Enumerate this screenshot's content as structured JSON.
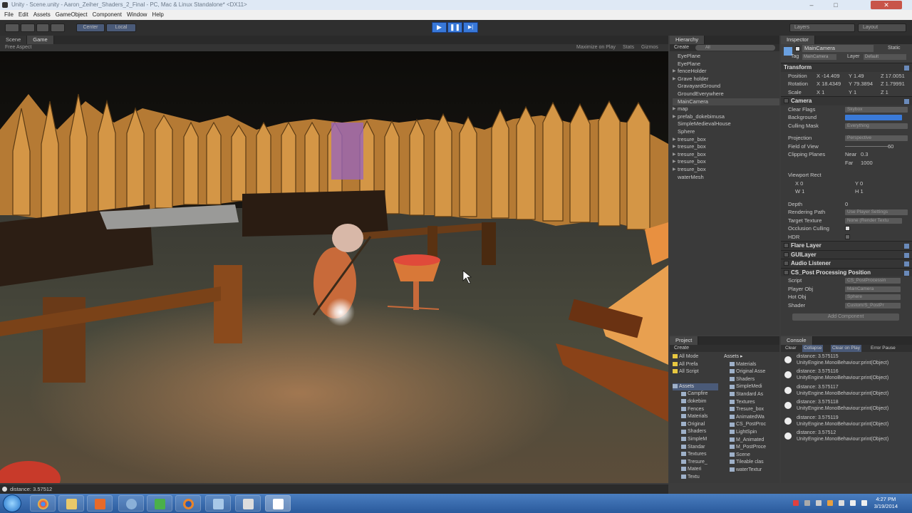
{
  "window": {
    "title": "Unity - Scene.unity - Aaron_Zeiher_Shaders_2_Final - PC, Mac & Linux Standalone* <DX11>",
    "min": "–",
    "max": "□",
    "close": "✕"
  },
  "menu": [
    "File",
    "Edit",
    "Assets",
    "GameObject",
    "Component",
    "Window",
    "Help"
  ],
  "toolbar": {
    "pivot": "Center",
    "space": "Local",
    "play": "▶",
    "pause": "❚❚",
    "step": "▶|",
    "layers": "Layers",
    "layout": "Layout"
  },
  "scene_tabs": {
    "scene": "Scene",
    "game": "Game",
    "aspect": "Free Aspect",
    "maximize": "Maximize on Play",
    "stats": "Stats",
    "gizmos": "Gizmos"
  },
  "status_message": "distance: 3.57512",
  "hierarchy": {
    "tab": "Hierarchy",
    "create": "Create",
    "search": "All",
    "items": [
      {
        "label": "EyePlane",
        "expand": false
      },
      {
        "label": "EyePlane",
        "expand": false
      },
      {
        "label": "fenceHolder",
        "expand": true
      },
      {
        "label": "Grave holder",
        "expand": true
      },
      {
        "label": "GravayardGround",
        "expand": false
      },
      {
        "label": "GroundEverywhere",
        "expand": false
      },
      {
        "label": "MainCamera",
        "expand": false,
        "selected": true
      },
      {
        "label": "map",
        "expand": true
      },
      {
        "label": "prefab_dokebimusa",
        "expand": true
      },
      {
        "label": "SimpleMedievalHouse",
        "expand": false
      },
      {
        "label": "Sphere",
        "expand": false
      },
      {
        "label": "tresure_box",
        "expand": true
      },
      {
        "label": "tresure_box",
        "expand": true
      },
      {
        "label": "tresure_box",
        "expand": true
      },
      {
        "label": "tresure_box",
        "expand": true
      },
      {
        "label": "tresure_box",
        "expand": true
      },
      {
        "label": "waterMesh",
        "expand": false
      }
    ]
  },
  "inspector": {
    "tab": "Inspector",
    "object_name": "MainCamera",
    "static": "Static",
    "tag_label": "Tag",
    "tag": "MainCamera",
    "layer_label": "Layer",
    "layer": "Default",
    "transform": {
      "title": "Transform",
      "position_label": "Position",
      "position": {
        "x": "-14.409",
        "y": "1.49",
        "z": "17.0051"
      },
      "rotation_label": "Rotation",
      "rotation": {
        "x": "18.4349",
        "y": "79.3894",
        "z": "1.79991"
      },
      "scale_label": "Scale",
      "scale": {
        "x": "1",
        "y": "1",
        "z": "1"
      }
    },
    "camera": {
      "title": "Camera",
      "clear_flags_label": "Clear Flags",
      "clear_flags": "Skybox",
      "background_label": "Background",
      "culling_mask_label": "Culling Mask",
      "culling_mask": "Everything",
      "projection_label": "Projection",
      "projection": "Perspective",
      "fov_label": "Field of View",
      "fov": "60",
      "clipping_label": "Clipping Planes",
      "near_label": "Near",
      "near": "0.3",
      "far_label": "Far",
      "far": "1000",
      "viewport_label": "Viewport Rect",
      "vp": {
        "x": "0",
        "y": "0",
        "w": "1",
        "h": "1"
      },
      "depth_label": "Depth",
      "depth": "0",
      "rendering_path_label": "Rendering Path",
      "rendering_path": "Use Player Settings",
      "target_texture_label": "Target Texture",
      "target_texture": "None (Render Textu",
      "occlusion_label": "Occlusion Culling",
      "hdr_label": "HDR"
    },
    "components": [
      "Flare Layer",
      "GUILayer",
      "Audio Listener"
    ],
    "post": {
      "title": "CS_Post Processing Position",
      "script_label": "Script",
      "script": "CS_PostProcessin",
      "player_label": "Player Obj",
      "player": "MainCamera",
      "hot_label": "Hot Obj",
      "hot": "Sphere",
      "shader_label": "Shader",
      "shader": "Custom/S_PostPr"
    },
    "add_component": "Add Component"
  },
  "project": {
    "tab": "Project",
    "create": "Create",
    "favorites": [
      "All Mode",
      "All Prefa",
      "All Script"
    ],
    "assets_root": "Assets",
    "tree": [
      "Campfire",
      "dokebim",
      "Fences",
      "Materials",
      "Original",
      "Shaders",
      "SimpleM",
      "Standar",
      "Textures",
      "Tresure_",
      "Materi",
      "Textu"
    ],
    "assets_header": "Assets ▸",
    "assets": [
      "Materials",
      "Original Asse",
      "Shaders",
      "SimpleMedi",
      "Standard As",
      "Textures",
      "Tresure_box",
      "AnimatedWa",
      "CS_PostProc",
      "LightSpin",
      "M_Animated",
      "M_PostProce",
      "Scene",
      "Tileable clas",
      "waterTextur"
    ]
  },
  "console": {
    "tab": "Console",
    "clear": "Clear",
    "collapse": "Collapse",
    "clear_on_play": "Clear on Play",
    "error_pause": "Error Pause",
    "entries": [
      {
        "line1": "distance: 3.575115",
        "line2": "UnityEngine.MonoBehaviour:print(Object)"
      },
      {
        "line1": "distance: 3.575116",
        "line2": "UnityEngine.MonoBehaviour:print(Object)"
      },
      {
        "line1": "distance: 3.575117",
        "line2": "UnityEngine.MonoBehaviour:print(Object)"
      },
      {
        "line1": "distance: 3.575118",
        "line2": "UnityEngine.MonoBehaviour:print(Object)"
      },
      {
        "line1": "distance: 3.575119",
        "line2": "UnityEngine.MonoBehaviour:print(Object)"
      },
      {
        "line1": "distance: 3.57512",
        "line2": "UnityEngine.MonoBehaviour:print(Object)"
      }
    ]
  },
  "taskbar": {
    "time": "4:27 PM",
    "date": "3/19/2014"
  }
}
